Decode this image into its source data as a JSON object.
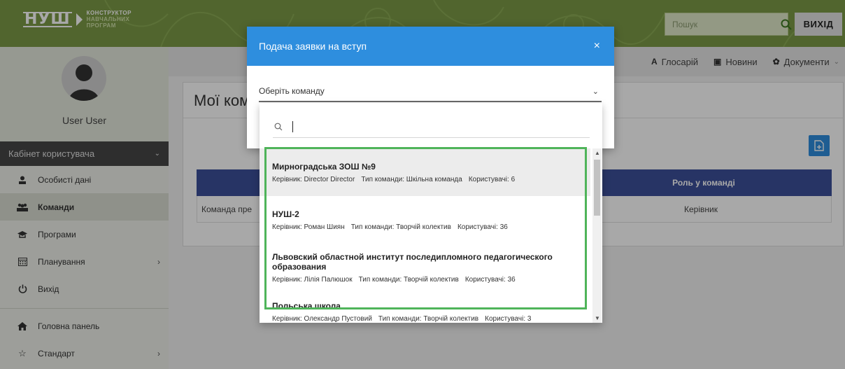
{
  "header": {
    "logo_mark": "НУШ",
    "logo_lines": [
      "КОНСТРУКТОР",
      "НАВЧАЛЬНИХ",
      "ПРОГРАМ"
    ],
    "search_placeholder": "Пошук",
    "search_icon": "search-icon",
    "logout_label": "ВИХІД"
  },
  "subnav": {
    "items": [
      {
        "icon": "A",
        "label": "Глосарій"
      },
      {
        "icon": "▣",
        "label": "Новини"
      },
      {
        "icon": "✿",
        "label": "Документи"
      }
    ]
  },
  "sidebar": {
    "username": "User User",
    "cabinet_label": "Кабінет користувача",
    "items": [
      {
        "label": "Особисті дані",
        "icon": "user-icon",
        "active": false,
        "has_chevron": false
      },
      {
        "label": "Команди",
        "icon": "team-icon",
        "active": true,
        "has_chevron": false
      },
      {
        "label": "Програми",
        "icon": "graduation-cap-icon",
        "active": false,
        "has_chevron": false
      },
      {
        "label": "Планування",
        "icon": "calendar-icon",
        "active": false,
        "has_chevron": true
      },
      {
        "label": "Вихід",
        "icon": "power-icon",
        "active": false,
        "has_chevron": false
      }
    ],
    "items_bottom": [
      {
        "label": "Головна панель",
        "icon": "home-icon",
        "has_chevron": false
      },
      {
        "label": "Стандарт",
        "icon": "star-icon",
        "has_chevron": true
      }
    ]
  },
  "main": {
    "title_visible": "Мої ком",
    "table": {
      "header_role": "Роль у команді",
      "rows": [
        {
          "team_visible": "Команда пре",
          "role": "Керівник"
        }
      ]
    }
  },
  "modal": {
    "title": "Подача заявки на вступ",
    "close": "×",
    "select_placeholder": "Оберіть команду",
    "search_value": "",
    "options": [
      {
        "name": "Мирноградська ЗОШ №9",
        "leader": "Керівник: Director Director",
        "type": "Тип команди: Шкільна команда",
        "users": "Користувачі: 6"
      },
      {
        "name": "НУШ-2",
        "leader": "Керівник: Роман Шиян",
        "type": "Тип команди: Творчій колектив",
        "users": "Користувачі: 36"
      },
      {
        "name": "Львовский областной институт последипломного педагогического образования",
        "leader": "Керівник: Лілія Палюшок",
        "type": "Тип команди: Творчій колектив",
        "users": "Користувачі: 36"
      },
      {
        "name": "Польська школа",
        "leader": "Керівник: Олександр Пустовий",
        "type": "Тип команди: Творчій колектив",
        "users": "Користувачі: 3"
      }
    ]
  },
  "colors": {
    "header_green": "#7c9a47",
    "modal_blue": "#2e8ede",
    "table_header": "#3c4f99",
    "highlight_frame": "#4fb45a"
  }
}
